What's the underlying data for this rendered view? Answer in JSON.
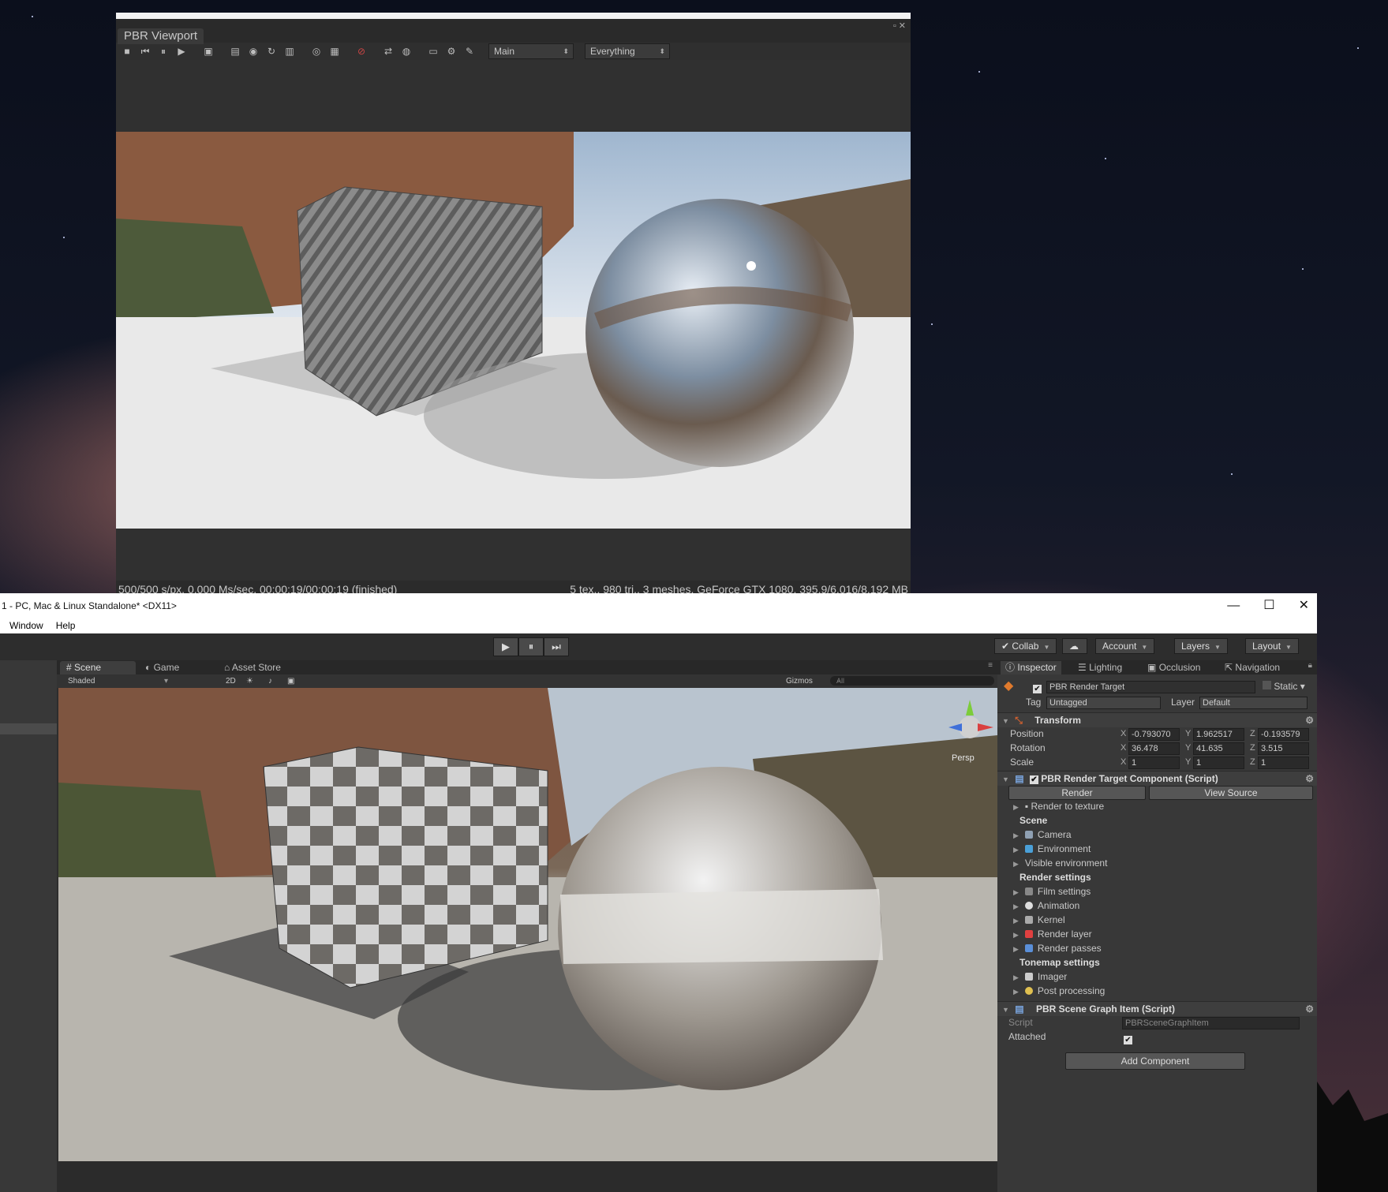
{
  "pbr_window": {
    "tab_title": "PBR Viewport",
    "camera_dropdown": "Main",
    "layer_dropdown": "Everything",
    "status_left": "500/500 s/px, 0.000 Ms/sec, 00:00:19/00:00:19 (finished)",
    "status_right": "5 tex., 980 tri., 3 meshes, GeForce GTX 1080, 395.9/6,016/8,192 MB"
  },
  "editor": {
    "title": "1 - PC, Mac & Linux Standalone* <DX11>",
    "menu": [
      "Window",
      "Help"
    ],
    "toolbar": {
      "collab": "Collab",
      "account": "Account",
      "layers": "Layers",
      "layout": "Layout"
    },
    "scene_tabs": [
      "Scene",
      "Game",
      "Asset Store"
    ],
    "scene_bar": {
      "shading": "Shaded",
      "mode_2d": "2D",
      "gizmos": "Gizmos",
      "search_placeholder": "All",
      "persp": "Persp"
    },
    "inspector_tabs": [
      "Inspector",
      "Lighting",
      "Occlusion",
      "Navigation"
    ]
  },
  "inspector": {
    "object_name": "PBR Render Target",
    "static_label": "Static",
    "tag_label": "Tag",
    "tag_value": "Untagged",
    "layer_label": "Layer",
    "layer_value": "Default",
    "transform": {
      "title": "Transform",
      "position_label": "Position",
      "position": {
        "x": "-0.793070",
        "y": "1.962517",
        "z": "-0.193579"
      },
      "rotation_label": "Rotation",
      "rotation": {
        "x": "36.478",
        "y": "41.635",
        "z": "3.515"
      },
      "scale_label": "Scale",
      "scale": {
        "x": "1",
        "y": "1",
        "z": "1"
      }
    },
    "render_component": {
      "title": "PBR Render Target Component (Script)",
      "render_button": "Render",
      "view_source_button": "View Source",
      "render_to_texture": "Render to texture",
      "scene_header": "Scene",
      "camera": "Camera",
      "environment": "Environment",
      "visible_environment": "Visible environment",
      "render_settings_header": "Render settings",
      "film_settings": "Film settings",
      "animation": "Animation",
      "kernel": "Kernel",
      "render_layer": "Render layer",
      "render_passes": "Render passes",
      "tonemap_header": "Tonemap settings",
      "imager": "Imager",
      "post_processing": "Post processing"
    },
    "scene_graph_component": {
      "title": "PBR Scene Graph Item (Script)",
      "script_label": "Script",
      "script_value": "PBRSceneGraphItem",
      "attached_label": "Attached"
    },
    "add_component": "Add Component"
  }
}
